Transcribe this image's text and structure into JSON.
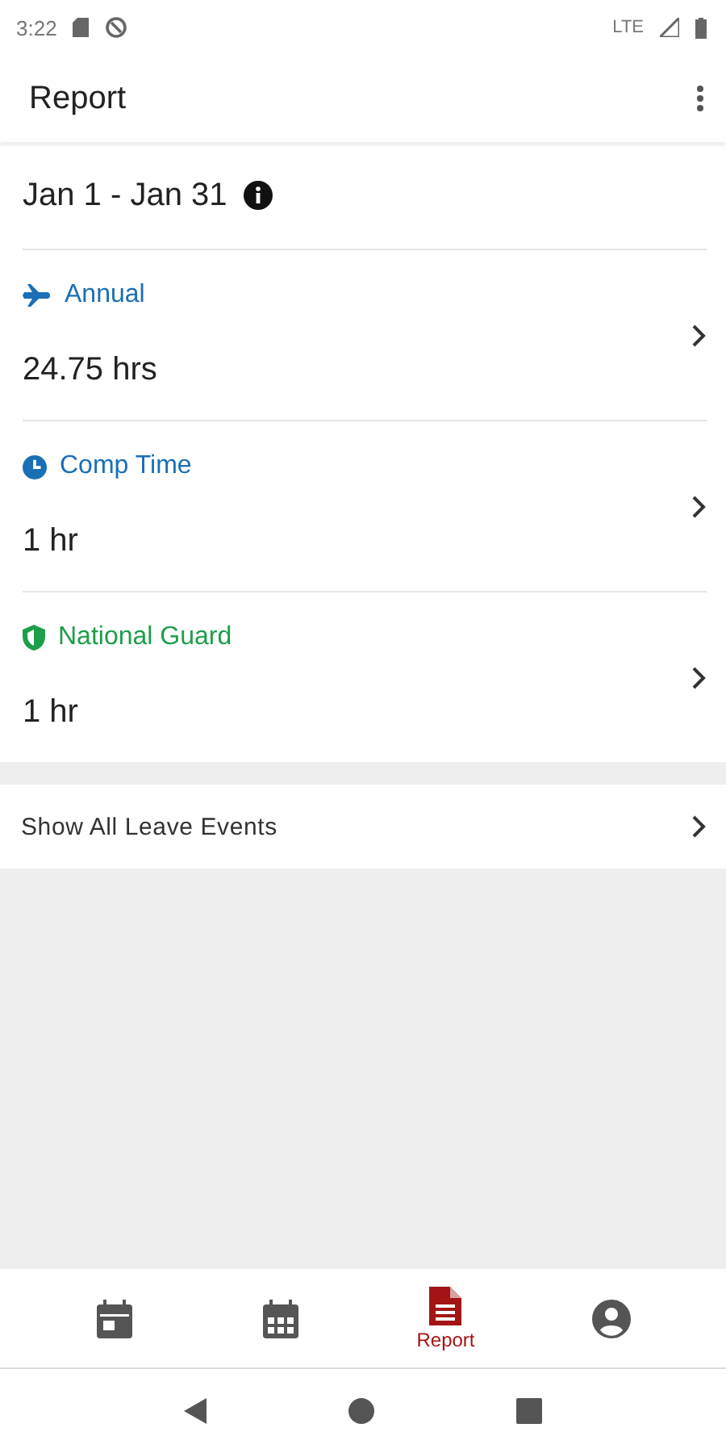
{
  "status_bar": {
    "time": "3:22",
    "network": "LTE"
  },
  "app_bar": {
    "title": "Report"
  },
  "period": {
    "label": "Jan 1 - Jan 31"
  },
  "leave_types": [
    {
      "kind": "plane",
      "name": "Annual",
      "color": "#1a6fb5",
      "amount": "24.75 hrs"
    },
    {
      "kind": "clock",
      "name": "Comp Time",
      "color": "#1a6fb5",
      "amount": "1 hr"
    },
    {
      "kind": "shield",
      "name": "National Guard",
      "color": "#1e9e4a",
      "amount": "1 hr"
    }
  ],
  "show_all": {
    "label": "Show All Leave Events"
  },
  "bottom_nav": [
    {
      "kind": "day",
      "selected": false
    },
    {
      "kind": "month",
      "selected": false
    },
    {
      "kind": "report",
      "selected": true,
      "label": "Report"
    },
    {
      "kind": "profile",
      "selected": false
    }
  ]
}
